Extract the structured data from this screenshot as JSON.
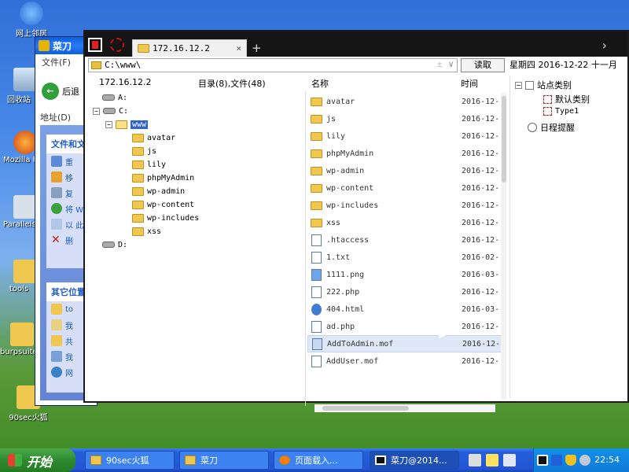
{
  "desktop": {
    "icons": [
      {
        "label": "网上邻居"
      },
      {
        "label": "回收站"
      },
      {
        "label": "Mozilla Firefox"
      },
      {
        "label": "Parallels Shared"
      },
      {
        "label": "tools"
      },
      {
        "label": "burpsuite"
      },
      {
        "label": "90sec火狐"
      }
    ]
  },
  "explorer": {
    "title": "菜刀",
    "menu_file": "文件(F)",
    "back": "后退",
    "address": "地址(D)",
    "panel1_title": "文件和文件夹任务",
    "panel1_items": [
      "重",
      "移",
      "复",
      "将 We",
      "以 此",
      "删"
    ],
    "panel2_title": "其它位置",
    "panel2_items": [
      "to",
      "我",
      "共",
      "我",
      "网"
    ]
  },
  "app": {
    "tab_title": "172.16.12.2",
    "tab_close": "×",
    "tab_add": "+",
    "chevron": "›",
    "address": "C:\\www\\",
    "address_hint": "±",
    "address_dropdown": "∨",
    "read_button": "读取",
    "date": "星期四 2016-12-22 十一月",
    "host": "172.16.12.2",
    "dir_summary": "目录(8),文件(48)",
    "col_name": "名称",
    "col_time": "时间",
    "tree": {
      "drive_a": "A:",
      "drive_c": "C:",
      "www": "www",
      "folders": [
        "avatar",
        "js",
        "lily",
        "phpMyAdmin",
        "wp-admin",
        "wp-content",
        "wp-includes",
        "xss"
      ],
      "drive_d": "D:",
      "expander_open": "−"
    },
    "files": [
      {
        "name": "avatar",
        "time": "2016-12-",
        "kind": "folder"
      },
      {
        "name": "js",
        "time": "2016-12-",
        "kind": "folder"
      },
      {
        "name": "lily",
        "time": "2016-12-",
        "kind": "folder"
      },
      {
        "name": "phpMyAdmin",
        "time": "2016-12-",
        "kind": "folder"
      },
      {
        "name": "wp-admin",
        "time": "2016-12-",
        "kind": "folder"
      },
      {
        "name": "wp-content",
        "time": "2016-12-",
        "kind": "folder"
      },
      {
        "name": "wp-includes",
        "time": "2016-12-",
        "kind": "folder"
      },
      {
        "name": "xss",
        "time": "2016-12-",
        "kind": "folder"
      },
      {
        "name": ".htaccess",
        "time": "2016-12-",
        "kind": "file"
      },
      {
        "name": "1.txt",
        "time": "2016-02-",
        "kind": "file"
      },
      {
        "name": "1111.png",
        "time": "2016-03-",
        "kind": "img"
      },
      {
        "name": "222.php",
        "time": "2016-12-",
        "kind": "file"
      },
      {
        "name": "404.html",
        "time": "2016-03-",
        "kind": "html"
      },
      {
        "name": "ad.php",
        "time": "2016-12-",
        "kind": "file"
      },
      {
        "name": "AddToAdmin.mof",
        "time": "2016-12-",
        "kind": "file",
        "highlight": true
      },
      {
        "name": "AddUser.mof",
        "time": "2016-12-",
        "kind": "file"
      }
    ],
    "right_panel": {
      "site_category": "站点类别",
      "default_category": "默认类别",
      "type1": "Type1",
      "schedule": "日程提醒",
      "expander": "−"
    }
  },
  "taskbar": {
    "start": "开始",
    "buttons": [
      {
        "label": "90sec火狐"
      },
      {
        "label": "菜刀"
      },
      {
        "label": "页面载入..."
      },
      {
        "label": "菜刀@2014..."
      }
    ],
    "clock": "22:54"
  }
}
